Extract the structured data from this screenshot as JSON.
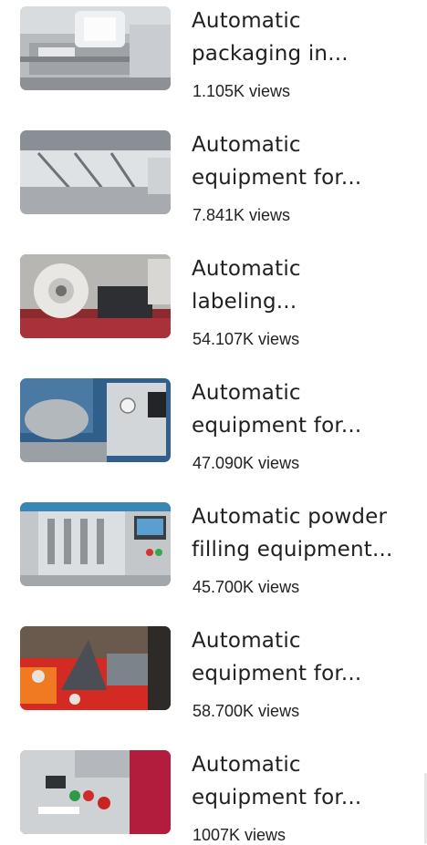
{
  "videos": [
    {
      "thumbnail_alt": "packaging machine with film roll",
      "title_line1": "Automatic",
      "title_line2": "packaging in...",
      "views": "1.105K views"
    },
    {
      "thumbnail_alt": "filling equipment with nozzles",
      "title_line1": "Automatic",
      "title_line2": "equipment for...",
      "views": "7.841K views"
    },
    {
      "thumbnail_alt": "labeling machine with label roll",
      "title_line1": "Automatic",
      "title_line2": "labeling...",
      "views": "54.107K views"
    },
    {
      "thumbnail_alt": "stainless steel tank with control panel",
      "title_line1": "Automatic",
      "title_line2": "equipment for...",
      "views": "47.090K views"
    },
    {
      "thumbnail_alt": "powder filling machine",
      "title_line1": "Automatic powder",
      "title_line2": "filling equipment...",
      "views": "45.700K views"
    },
    {
      "thumbnail_alt": "equipment on red table",
      "title_line1": "Automatic",
      "title_line2": "equipment for...",
      "views": "58.700K views"
    },
    {
      "thumbnail_alt": "control panel with buttons",
      "title_line1": "Automatic",
      "title_line2": "equipment for...",
      "views": "1007K views"
    }
  ]
}
